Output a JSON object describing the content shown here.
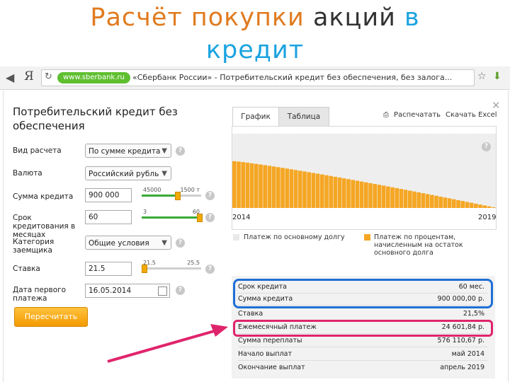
{
  "slide": {
    "title_part1": "Расчёт покупки",
    "title_part2": "акций",
    "title_part3": "в",
    "title_line2": "кредит"
  },
  "browser": {
    "back": "◀",
    "forward": "▶",
    "logo": "Я",
    "domain": "www.sberbank.ru",
    "page_title": "«Сбербанк России» - Потребительский кредит без обеспечения, без залога..."
  },
  "form": {
    "title": "Потребительский кредит без обеспечения",
    "fields": {
      "calc_type": {
        "label": "Вид расчета",
        "value": "По сумме кредита"
      },
      "currency": {
        "label": "Валюта",
        "value": "Российский рубль"
      },
      "amount": {
        "label": "Сумма кредита",
        "value": "900 000",
        "min": "45000",
        "max": "1500 т"
      },
      "term": {
        "label": "Срок кредитования в месяцах",
        "value": "60",
        "min": "3",
        "max": "60"
      },
      "category": {
        "label": "Категория заемщика",
        "value": "Общие условия"
      },
      "rate": {
        "label": "Ставка",
        "value": "21.5",
        "min": "21.5",
        "max": "25.5"
      },
      "first_payment": {
        "label": "Дата первого платежа",
        "value": "16.05.2014"
      }
    },
    "sliders": {
      "amount_level": 0.6,
      "term_level": 1.0,
      "rate_level": 0.0
    },
    "recalc_button": "Пересчитать"
  },
  "panel": {
    "tabs": {
      "graph": "График",
      "table": "Таблица"
    },
    "print": "Распечатать",
    "excel": "Скачать Excel"
  },
  "chart_data": {
    "type": "area",
    "x_start_label": "2014",
    "x_end_label": "2019",
    "series": [
      {
        "name": "Платеж по процентам, начисленным на остаток основного долга",
        "color": "#f5a623"
      },
      {
        "name": "Платеж по основному долгу",
        "color": "#eeeeee"
      }
    ],
    "interest_share_start": 0.63,
    "interest_share_end": 0.01
  },
  "results": {
    "rows": [
      {
        "label": "Срок кредита",
        "value": "60 мес."
      },
      {
        "label": "Сумма кредита",
        "value": "900 000,00 р."
      },
      {
        "label": "Ставка",
        "value": "21,5%"
      },
      {
        "label": "Ежемесячный платеж",
        "value": "24 601,84 р."
      },
      {
        "label": "Сумма переплаты",
        "value": "576 110,67 р."
      },
      {
        "label": "Начало выплат",
        "value": "май 2014"
      },
      {
        "label": "Окончание выплат",
        "value": "апрель 2019"
      }
    ]
  },
  "colors": {
    "accent_orange": "#e07b1f",
    "accent_blue": "#1aa3e0",
    "highlight_blue": "#1f6fd6",
    "highlight_pink": "#e0246c",
    "chart_orange": "#f5a623",
    "slider_green": "#3aaa35"
  }
}
